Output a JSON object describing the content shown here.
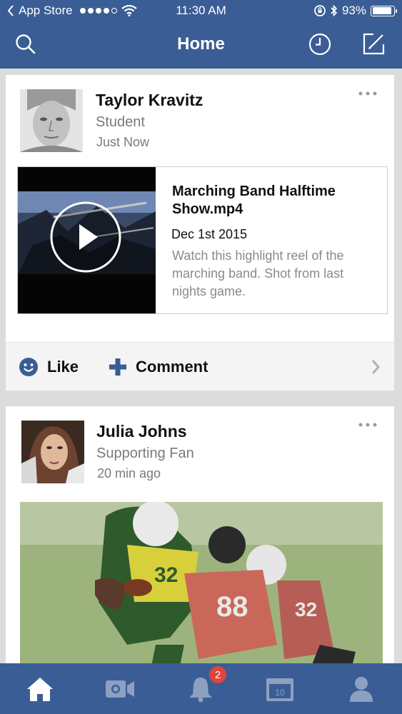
{
  "status_bar": {
    "carrier": "App Store",
    "time": "11:30 AM",
    "battery": "93%"
  },
  "nav": {
    "title": "Home",
    "icons": [
      "search-icon",
      "clock-icon",
      "compose-icon"
    ]
  },
  "posts": [
    {
      "author": "Taylor Kravitz",
      "role": "Student",
      "time": "Just Now",
      "attachment": {
        "title": "Marching Band Halftime Show.mp4",
        "date": "Dec 1st 2015",
        "description": "Watch this highlight reel of the marching band. Shot from last nights game."
      },
      "actions": {
        "like": "Like",
        "comment": "Comment"
      }
    },
    {
      "author": "Julia Johns",
      "role": "Supporting Fan",
      "time": "20 min ago"
    }
  ],
  "tabbar": {
    "tabs": [
      "home-icon",
      "video-icon",
      "bell-icon",
      "calendar-icon",
      "profile-icon"
    ],
    "calendar_day": "10",
    "notification_count": "2"
  },
  "colors": {
    "brand": "#3a5d95",
    "badge": "#e0443a"
  }
}
